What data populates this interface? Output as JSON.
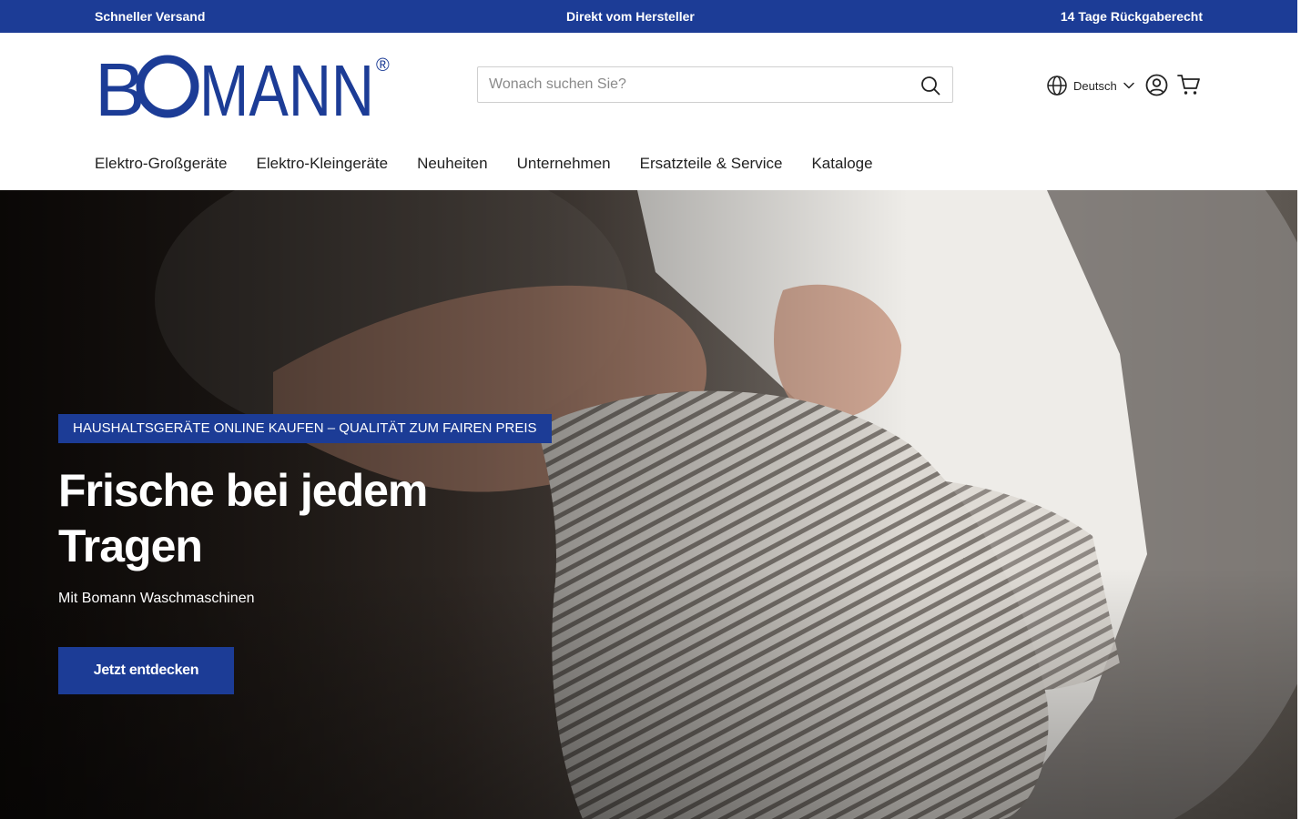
{
  "colors": {
    "brand": "#1c3c96",
    "text": "#222222",
    "white": "#ffffff"
  },
  "announcement_bar": {
    "left": "Schneller Versand",
    "center": "Direkt vom Hersteller",
    "right": "14 Tage Rückgaberecht"
  },
  "header": {
    "logo_text": "BOMANN",
    "logo_mark": "®",
    "search": {
      "placeholder": "Wonach suchen Sie?",
      "value": "",
      "icon": "search-icon"
    },
    "language": {
      "icon": "globe-icon",
      "label": "Deutsch",
      "chevron": "chevron-down-icon"
    },
    "account_icon": "user-circle-icon",
    "cart_icon": "cart-icon"
  },
  "nav": {
    "items": [
      "Elektro-Großgeräte",
      "Elektro-Kleingeräte",
      "Neuheiten",
      "Unternehmen",
      "Ersatzteile & Service",
      "Kataloge"
    ]
  },
  "hero": {
    "badge": "HAUSHALTSGERÄTE ONLINE KAUFEN – QUALITÄT ZUM FAIREN PREIS",
    "title": "Frische bei jedem Tragen",
    "subtitle": "Mit Bomann Waschmaschinen",
    "cta": "Jetzt entdecken"
  }
}
